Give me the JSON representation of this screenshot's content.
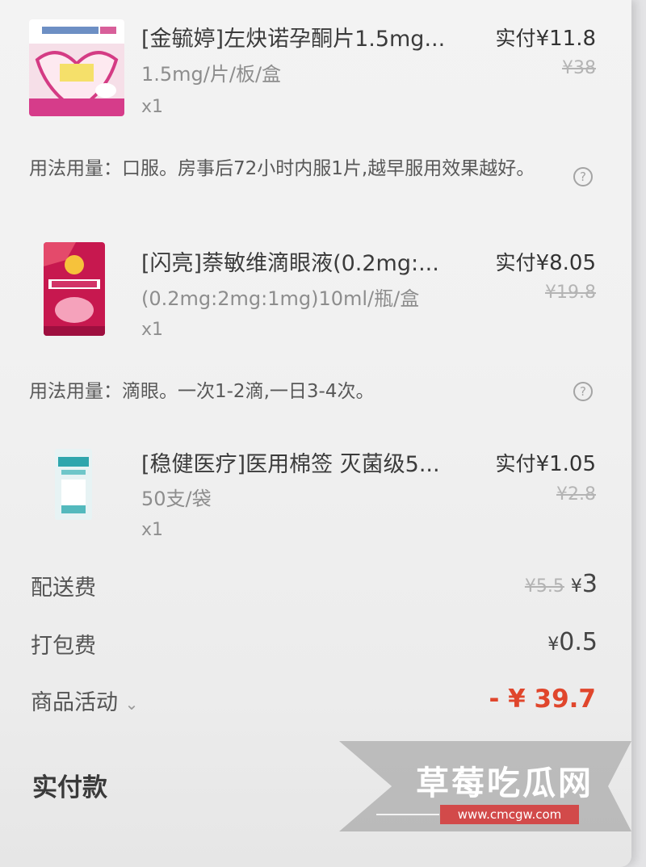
{
  "items": [
    {
      "name": "[金毓婷]左炔诺孕酮片1.5mg...",
      "spec": "1.5mg/片/板/盒",
      "qty": "x1",
      "paid_label": "实付",
      "paid_price": "¥11.8",
      "original_price": "¥38",
      "usage": "用法用量：口服。房事后72小时内服1片,越早服用效果越好。",
      "thumb_icon": "pink-medicine-box-icon"
    },
    {
      "name": "[闪亮]萘敏维滴眼液(0.2mg:...",
      "spec": "(0.2mg:2mg:1mg)10ml/瓶/盒",
      "qty": "x1",
      "paid_label": "实付",
      "paid_price": "¥8.05",
      "original_price": "¥19.8",
      "usage": "用法用量：滴眼。一次1-2滴,一日3-4次。",
      "thumb_icon": "eye-drops-box-icon"
    },
    {
      "name": "[稳健医疗]医用棉签 灭菌级5...",
      "spec": "50支/袋",
      "qty": "x1",
      "paid_label": "实付",
      "paid_price": "¥1.05",
      "original_price": "¥2.8",
      "thumb_icon": "cotton-swab-bag-icon"
    }
  ],
  "help_icon": "question-circle-icon",
  "fees": {
    "delivery": {
      "label": "配送费",
      "original": "¥5.5",
      "sym": "¥",
      "value": "3"
    },
    "packing": {
      "label": "打包费",
      "sym": "¥",
      "value": "0.5"
    },
    "activity": {
      "label": "商品活动",
      "chevron": "⌄",
      "value": "- ¥ 39.7"
    }
  },
  "total": {
    "label": "实付款"
  },
  "watermark": {
    "title": "草莓吃瓜网",
    "url": "www.cmcgw.com"
  },
  "colors": {
    "accent": "#e0462c",
    "watermark_badge": "#d24a4a"
  }
}
